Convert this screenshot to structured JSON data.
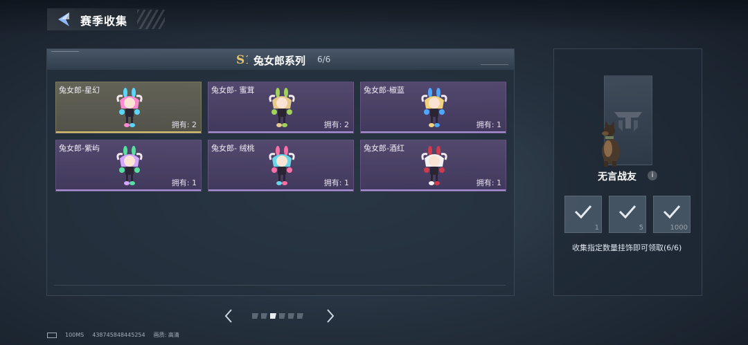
{
  "header": {
    "title": "赛季收集"
  },
  "series": {
    "badge": "S1",
    "title": "兔女郎系列",
    "count": "6/6"
  },
  "items": [
    {
      "name": "兔女郎-星幻",
      "owned": "拥有: 2",
      "rarity": "gold",
      "hair": "#ff8ad1",
      "accent": "#5ad6ff"
    },
    {
      "name": "兔女郎- 蜜茸",
      "owned": "拥有: 2",
      "rarity": "purple",
      "hair": "#e7c98a",
      "accent": "#9fd35a"
    },
    {
      "name": "兔女郎-椒蓝",
      "owned": "拥有: 1",
      "rarity": "purple",
      "hair": "#f2d27a",
      "accent": "#4fa7ff"
    },
    {
      "name": "兔女郎-紫屿",
      "owned": "拥有: 1",
      "rarity": "purple",
      "hair": "#d5a6ff",
      "accent": "#58e0a0"
    },
    {
      "name": "兔女郎- 绒桃",
      "owned": "拥有: 1",
      "rarity": "purple",
      "hair": "#6ad7e8",
      "accent": "#ff6fa8"
    },
    {
      "name": "兔女郎-酒红",
      "owned": "拥有: 1",
      "rarity": "purple",
      "hair": "#f2f2f2",
      "accent": "#d03a4e"
    }
  ],
  "pagination": {
    "pages": 6,
    "active_page": 3
  },
  "reward": {
    "name": "无言战友",
    "info_icon": "i",
    "tiers": [
      {
        "num": "1",
        "claimed": true
      },
      {
        "num": "5",
        "claimed": true
      },
      {
        "num": "1000",
        "claimed": true
      }
    ],
    "description": "收集指定数量挂饰即可领取(6/6)"
  },
  "status_bar": {
    "ping": "100MS",
    "id": "438745848445254",
    "quality": "画质: 高清"
  }
}
